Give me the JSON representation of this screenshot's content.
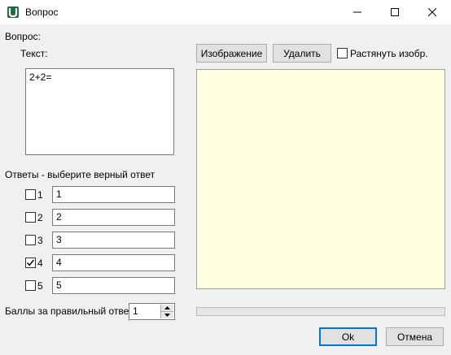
{
  "window": {
    "title": "Вопрос",
    "icon": "app-u-icon"
  },
  "question": {
    "group_label": "Вопрос:",
    "text_label": "Текст:",
    "text_value": "2+2="
  },
  "image": {
    "image_button": "Изображение",
    "delete_button": "Удалить",
    "stretch_label": "Растянуть изобр.",
    "stretch_checked": false,
    "panel_color": "#ffffe1"
  },
  "answers": {
    "header": "Ответы - выберите верный ответ",
    "items": [
      {
        "num": "1",
        "value": "1",
        "checked": false
      },
      {
        "num": "2",
        "value": "2",
        "checked": false
      },
      {
        "num": "3",
        "value": "3",
        "checked": false
      },
      {
        "num": "4",
        "value": "4",
        "checked": true
      },
      {
        "num": "5",
        "value": "5",
        "checked": false
      }
    ]
  },
  "score": {
    "label": "Баллы за правильный ответ:",
    "value": "1"
  },
  "progress": {
    "value_percent": 0
  },
  "footer": {
    "ok_label": "Ok",
    "cancel_label": "Отмена"
  }
}
